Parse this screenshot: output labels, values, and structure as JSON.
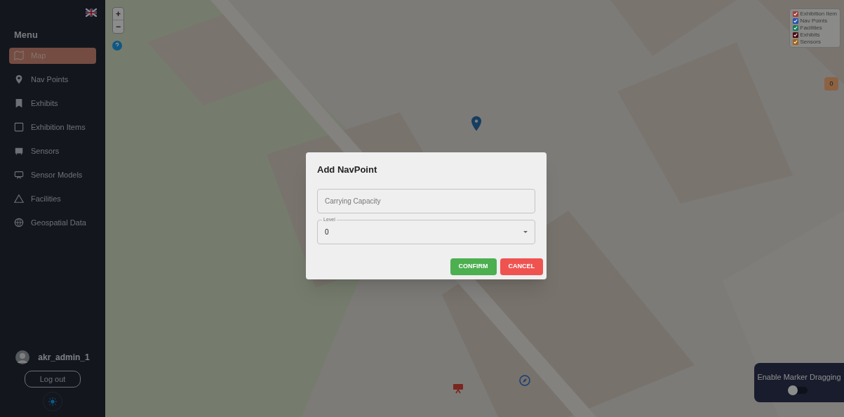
{
  "sidebar": {
    "title": "Menu",
    "items": [
      {
        "label": "Map",
        "selected": true
      },
      {
        "label": "Nav Points",
        "selected": false
      },
      {
        "label": "Exhibits",
        "selected": false
      },
      {
        "label": "Exhibition Items",
        "selected": false
      },
      {
        "label": "Sensors",
        "selected": false
      },
      {
        "label": "Sensor Models",
        "selected": false
      },
      {
        "label": "Facilities",
        "selected": false
      },
      {
        "label": "Geospatial Data",
        "selected": false
      }
    ],
    "user": {
      "name": "akr_admin_1"
    },
    "logout": "Log out"
  },
  "map": {
    "zoom_controls": [
      "+",
      "−"
    ],
    "legend": [
      {
        "label": "Exhibition Item",
        "checked": true,
        "color": "#a0403a"
      },
      {
        "label": "Nav Points",
        "checked": true,
        "color": "#2a55a8"
      },
      {
        "label": "Facilities",
        "checked": true,
        "color": "#1a7a5c"
      },
      {
        "label": "Exhibits",
        "checked": true,
        "color": "#4a0c16"
      },
      {
        "label": "Sensors",
        "checked": true,
        "color": "#a0621a"
      }
    ],
    "counter": "0",
    "drag_panel": {
      "label": "Enable Marker Dragging",
      "on": false
    }
  },
  "dialog": {
    "title": "Add NavPoint",
    "fields": [
      {
        "kind": "text",
        "placeholder": "Carrying Capacity"
      },
      {
        "kind": "select",
        "label": "Level",
        "value": "0"
      }
    ],
    "buttons": [
      {
        "label": "CONFIRM",
        "kind": "confirm"
      },
      {
        "label": "CANCEL",
        "kind": "cancel"
      }
    ]
  }
}
